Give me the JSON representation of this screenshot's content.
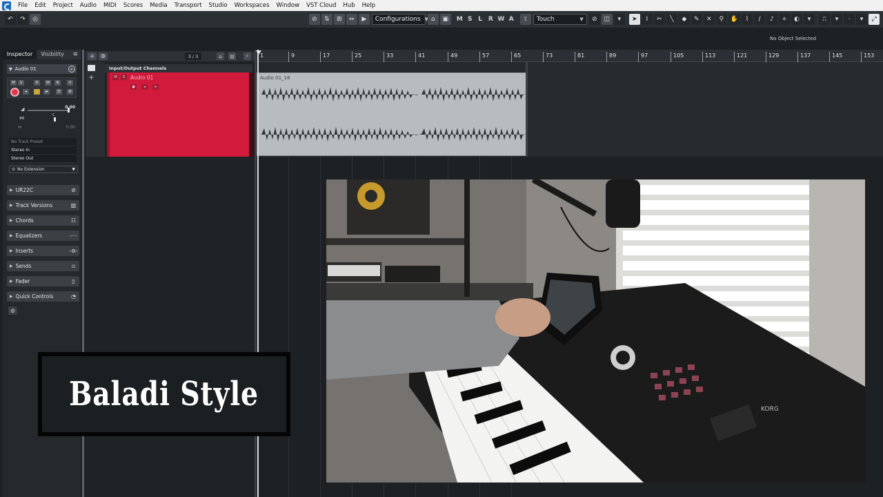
{
  "menu": {
    "items": [
      "File",
      "Edit",
      "Project",
      "Audio",
      "MIDI",
      "Scores",
      "Media",
      "Transport",
      "Studio",
      "Workspaces",
      "Window",
      "VST Cloud",
      "Hub",
      "Help"
    ]
  },
  "toolbar": {
    "configurations_label": "Configurations",
    "mode_letters": [
      "M",
      "S",
      "L",
      "R",
      "W",
      "A"
    ],
    "automation_mode": "Touch",
    "no_object": "No Object Selected"
  },
  "inspector": {
    "tab_inspector": "Inspector",
    "tab_visibility": "Visibility",
    "track_name": "Audio 01",
    "volume_value": "0.00",
    "pan_value": "C",
    "delay_value": "0.00",
    "no_track_preset": "No Track Preset",
    "input": "Stereo In",
    "output": "Stereo Out",
    "extension": "No Extension",
    "sections": [
      "UR22C",
      "Track Versions",
      "Chords",
      "Equalizers",
      "Inserts",
      "Sends",
      "Fader",
      "Quick Controls"
    ]
  },
  "tracklist": {
    "count": "3 / 3",
    "folder_name": "Input/Output Channels",
    "track_name": "Audio 01"
  },
  "ruler": {
    "ticks": [
      "1",
      "9",
      "17",
      "25",
      "33",
      "41",
      "49",
      "57",
      "65",
      "73",
      "81",
      "89",
      "97",
      "105",
      "113",
      "121",
      "129",
      "137",
      "145",
      "153"
    ]
  },
  "event": {
    "name": "Audio 01_16"
  },
  "overlay": {
    "title": "Baladi Style"
  },
  "colors": {
    "track_red": "#d11a3c",
    "event_gray": "#b7bcbf",
    "record_red": "#e0374b"
  }
}
